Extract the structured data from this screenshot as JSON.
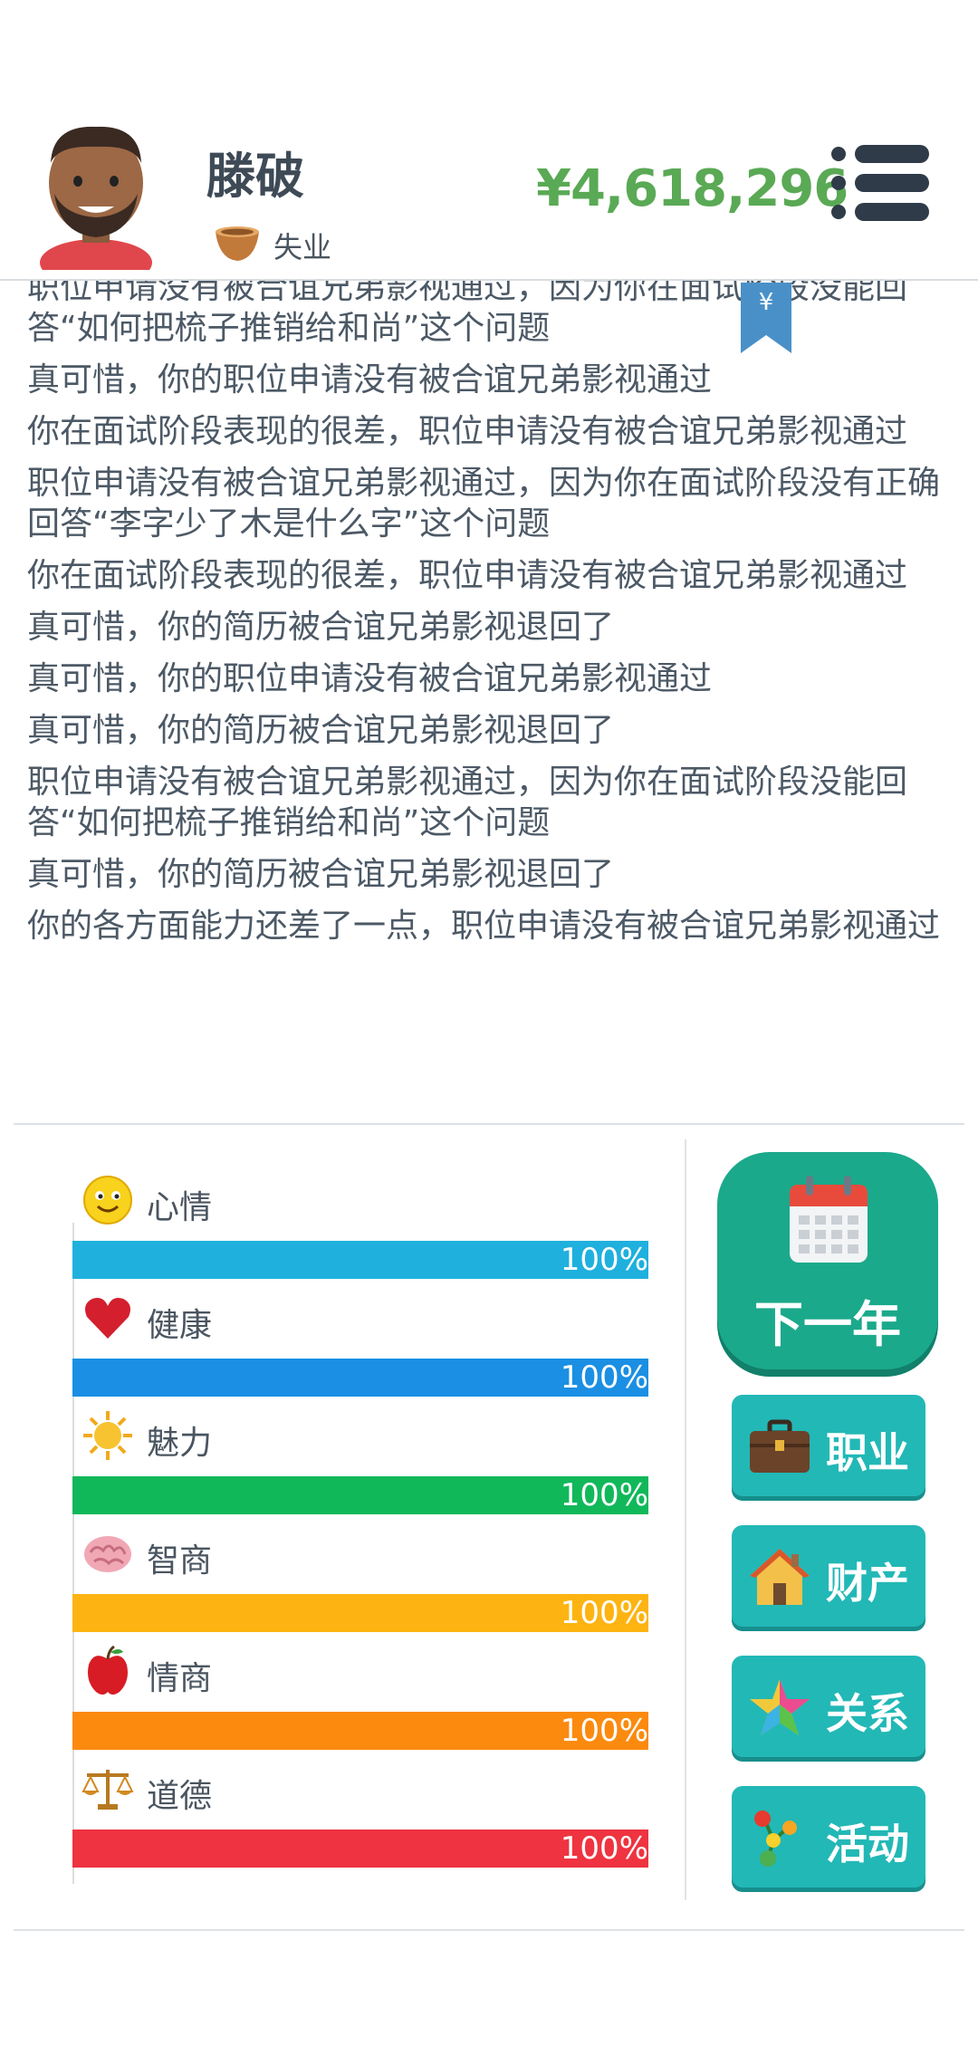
{
  "header": {
    "player_name": "滕破",
    "job_status": "失业",
    "money": "¥4,618,296"
  },
  "bookmark_symbol": "¥",
  "log": [
    "职位申请没有被合谊兄弟影视通过，因为你在面试阶段没能回答“如何把梳子推销给和尚”这个问题",
    "真可惜，你的职位申请没有被合谊兄弟影视通过",
    "你在面试阶段表现的很差，职位申请没有被合谊兄弟影视通过",
    "职位申请没有被合谊兄弟影视通过，因为你在面试阶段没有正确回答“李字少了木是什么字”这个问题",
    "你在面试阶段表现的很差，职位申请没有被合谊兄弟影视通过",
    "真可惜，你的简历被合谊兄弟影视退回了",
    "真可惜，你的职位申请没有被合谊兄弟影视通过",
    "真可惜，你的简历被合谊兄弟影视退回了",
    "职位申请没有被合谊兄弟影视通过，因为你在面试阶段没能回答“如何把梳子推销给和尚”这个问题",
    "真可惜，你的简历被合谊兄弟影视退回了",
    "你的各方面能力还差了一点，职位申请没有被合谊兄弟影视通过"
  ],
  "stats": [
    {
      "label": "心情",
      "value": "100%",
      "level": 1.0,
      "color": "#1fb0dd",
      "icon": "smiley-icon"
    },
    {
      "label": "健康",
      "value": "100%",
      "level": 1.0,
      "color": "#1a8fe3",
      "icon": "heart-icon"
    },
    {
      "label": "魅力",
      "value": "100%",
      "level": 1.0,
      "color": "#11b85a",
      "icon": "sun-icon"
    },
    {
      "label": "智商",
      "value": "100%",
      "level": 1.0,
      "color": "#fdb412",
      "icon": "brain-icon"
    },
    {
      "label": "情商",
      "value": "100%",
      "level": 1.0,
      "color": "#fb8a0f",
      "icon": "apple-icon"
    },
    {
      "label": "道德",
      "value": "100%",
      "level": 1.0,
      "color": "#ef3340",
      "icon": "scales-icon"
    }
  ],
  "actions": {
    "next_year": "下一年",
    "career": "职业",
    "property": "财产",
    "relations": "关系",
    "activities": "活动"
  }
}
